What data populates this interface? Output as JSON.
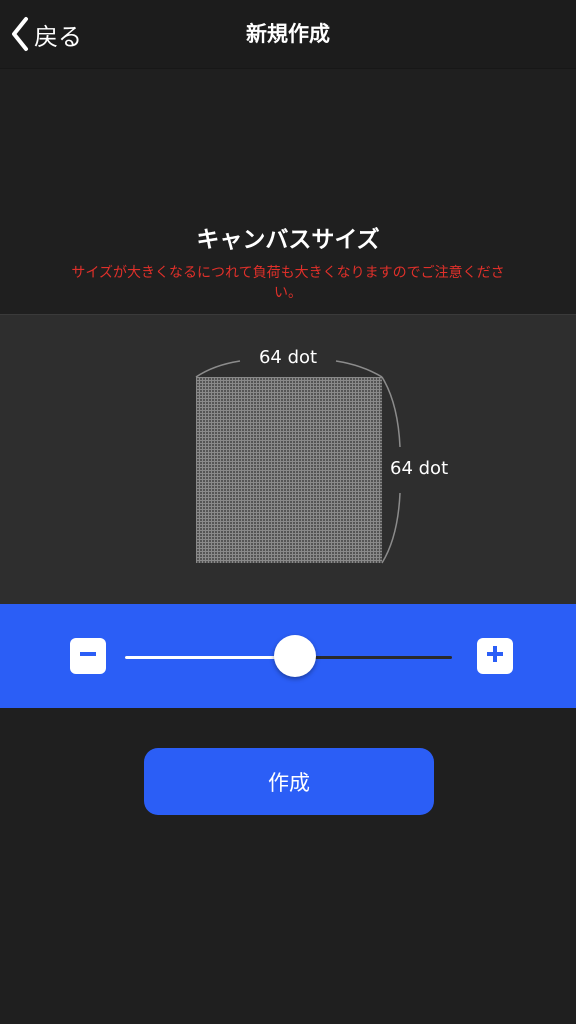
{
  "nav": {
    "back_label": "戻る",
    "title": "新規作成"
  },
  "canvas_size": {
    "title": "キャンバスサイズ",
    "warning": "サイズが大きくなるにつれて負荷も大きくなりますのでご注意ください。",
    "width_label": "64 dot",
    "height_label": "64 dot"
  },
  "slider": {
    "value_fraction": 0.52
  },
  "create_button": {
    "label": "作成"
  },
  "colors": {
    "accent": "#2b5ef6",
    "warning": "#e0302a",
    "background": "#1f1f1f",
    "panel": "#2e2e2e"
  },
  "icons": {
    "back": "chevron-left-icon",
    "minus": "minus-icon",
    "plus": "plus-icon"
  }
}
